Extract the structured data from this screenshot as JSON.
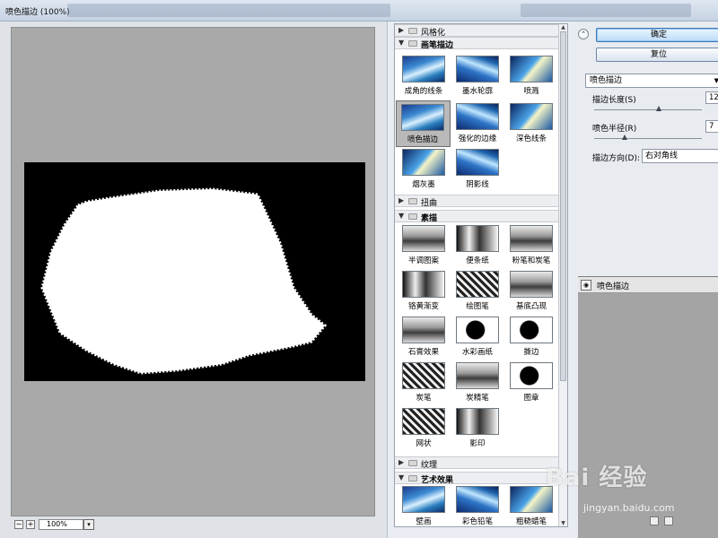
{
  "window": {
    "title": "喷色描边 (100%)"
  },
  "preview": {
    "zoom": "100%",
    "zoom_out": "−",
    "zoom_in": "+"
  },
  "gallery": {
    "categories": [
      {
        "label": "风格化",
        "open": false
      },
      {
        "label": "画笔描边",
        "open": true,
        "items": [
          "成角的线条",
          "墨水轮廓",
          "喷溅",
          "喷色描边",
          "强化的边缘",
          "深色线条",
          "烟灰墨",
          "阴影线"
        ]
      },
      {
        "label": "扭曲",
        "open": false
      },
      {
        "label": "素描",
        "open": true,
        "items": [
          "半调图案",
          "便条纸",
          "粉笔和炭笔",
          "铬黄渐变",
          "绘图笔",
          "基底凸现",
          "石膏效果",
          "水彩画纸",
          "撕边",
          "炭笔",
          "炭精笔",
          "图章",
          "网状",
          "影印"
        ]
      },
      {
        "label": "纹理",
        "open": false
      },
      {
        "label": "艺术效果",
        "open": true,
        "items": [
          "壁画",
          "彩色铅笔",
          "粗糙蜡笔"
        ]
      }
    ],
    "selected": "喷色描边"
  },
  "controls": {
    "ok_label": "确定",
    "reset_label": "复位",
    "filter_select": "喷色描边",
    "stroke_length_label": "描边长度(S)",
    "stroke_length_value": "12",
    "stroke_length_level": 0.6,
    "spray_radius_label": "喷色半径(R)",
    "spray_radius_value": "7",
    "spray_radius_level": 0.28,
    "direction_label": "描边方向(D):",
    "direction_value": "右对角线"
  },
  "layers": {
    "items": [
      "喷色描边"
    ]
  },
  "watermark": {
    "brand": "Bai 经验",
    "url": "jingyan.baidu.com"
  }
}
